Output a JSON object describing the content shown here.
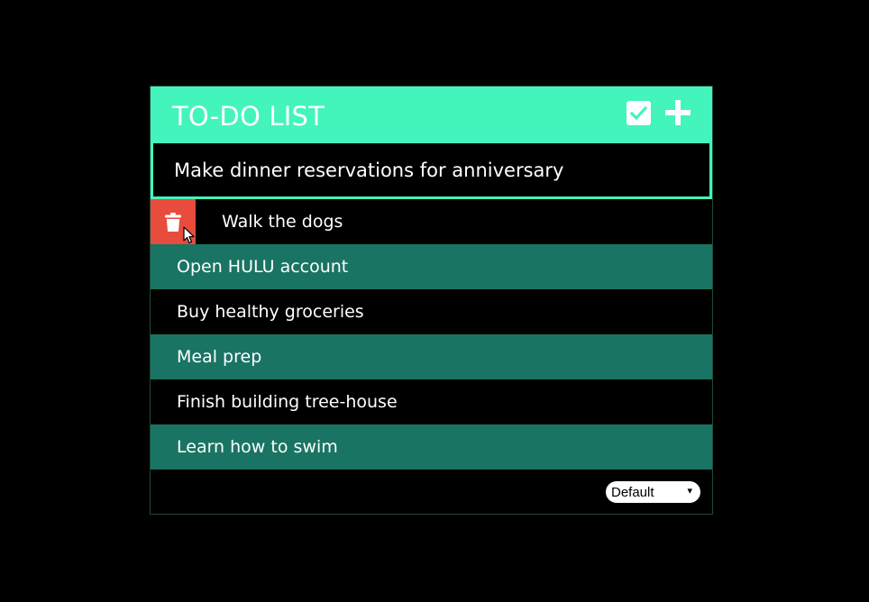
{
  "header": {
    "title": "TO-DO LIST",
    "complete_icon": "checkbox-icon",
    "add_icon": "plus-icon"
  },
  "new_task": {
    "value": "Make dinner reservations for anniversary"
  },
  "tasks": [
    {
      "label": "Walk the dogs"
    },
    {
      "label": "Open HULU account"
    },
    {
      "label": "Buy healthy groceries"
    },
    {
      "label": "Meal prep"
    },
    {
      "label": "Finish building tree-house"
    },
    {
      "label": "Learn how to swim"
    }
  ],
  "footer": {
    "sort_selected": "Default",
    "sort_arrow": "▾"
  },
  "colors": {
    "accent": "#43f4bc",
    "row_alt": "#1a7463",
    "delete": "#e74c3c",
    "background": "#000000"
  },
  "icons": {
    "delete": "trash-icon",
    "pointer": "mouse-pointer-icon"
  }
}
